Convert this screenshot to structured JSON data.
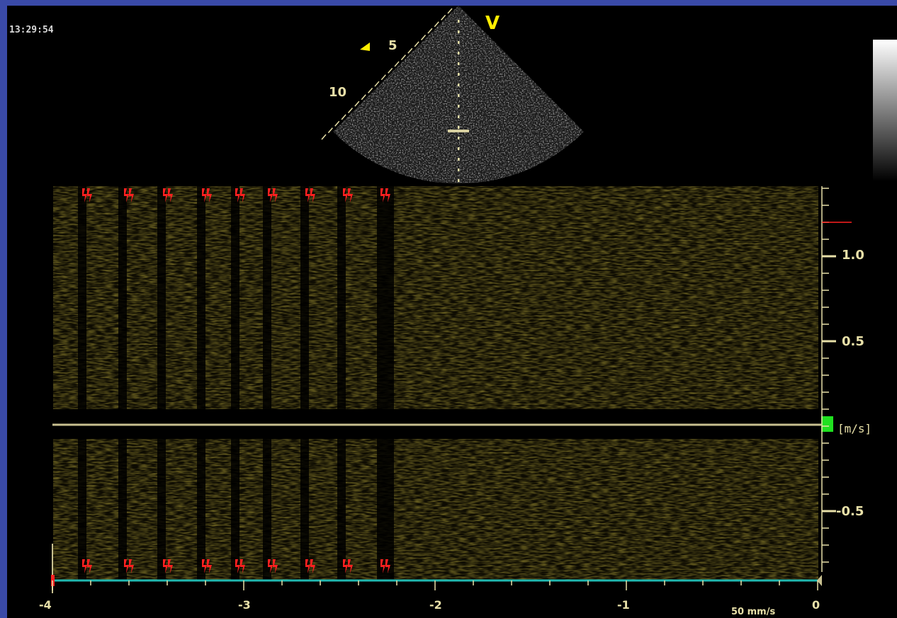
{
  "clock": "13:29:54",
  "sector": {
    "mode_label": "V",
    "depth_labels": [
      "5",
      "10"
    ]
  },
  "doppler": {
    "velocity_unit": "[m/s]",
    "velocity_ticks": [
      "1.0",
      "0.5",
      "-0.5"
    ],
    "time_ticks": [
      "-4",
      "-3",
      "-2",
      "-1",
      "0"
    ],
    "sweep_speed": "50 mm/s",
    "ecg_markers": 9
  },
  "colors": {
    "background": "#3a4aa8",
    "screen": "#000000",
    "axis": "#e8e0a8",
    "baseline": "#c8c090",
    "timeline": "#20b8b0",
    "marker_red": "#ff2020",
    "marker_green": "#20e020",
    "highlight_yellow": "#ffee00"
  }
}
